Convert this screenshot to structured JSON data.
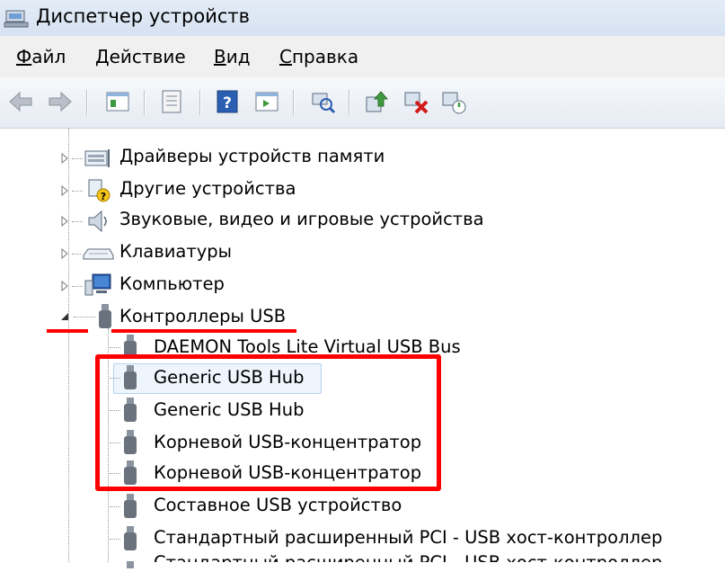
{
  "window": {
    "title": "Диспетчер устройств"
  },
  "menu": [
    {
      "label_u": "Ф",
      "label_rest": "айл"
    },
    {
      "label_u": "Д",
      "label_rest": "ействие"
    },
    {
      "label_u": "В",
      "label_rest": "ид"
    },
    {
      "label_u": "С",
      "label_rest": "правка"
    }
  ],
  "toolbar": {
    "buttons": [
      "back",
      "forward",
      "tree-view",
      "properties",
      "help",
      "scan-hardware",
      "show-hidden",
      "update-driver",
      "uninstall",
      "enable"
    ]
  },
  "tree": {
    "categories": [
      {
        "label": "Драйверы устройств памяти",
        "icon": "memory-driver-icon"
      },
      {
        "label": "Другие устройства",
        "icon": "unknown-device-icon"
      },
      {
        "label": "Звуковые, видео и игровые устройства",
        "icon": "speaker-icon"
      },
      {
        "label": "Клавиатуры",
        "icon": "keyboard-icon"
      },
      {
        "label": "Компьютер",
        "icon": "computer-icon"
      },
      {
        "label": "Контроллеры USB",
        "icon": "usb-plug-icon",
        "expanded": true
      }
    ],
    "usb_children": [
      {
        "label": "DAEMON Tools Lite Virtual USB Bus"
      },
      {
        "label": "Generic USB Hub",
        "selected": true
      },
      {
        "label": "Generic USB Hub"
      },
      {
        "label": "Корневой USB-концентратор"
      },
      {
        "label": "Корневой USB-концентратор"
      },
      {
        "label": "Составное USB устройство"
      },
      {
        "label": "Стандартный расширенный PCI - USB хост-контроллер"
      },
      {
        "label": "Стандартный расширенный PCI - USB хост-контроллер"
      }
    ]
  },
  "colors": {
    "highlight": "#ff0000",
    "selection_bg": "#eef5fd",
    "selection_border": "#b6d2f0"
  }
}
